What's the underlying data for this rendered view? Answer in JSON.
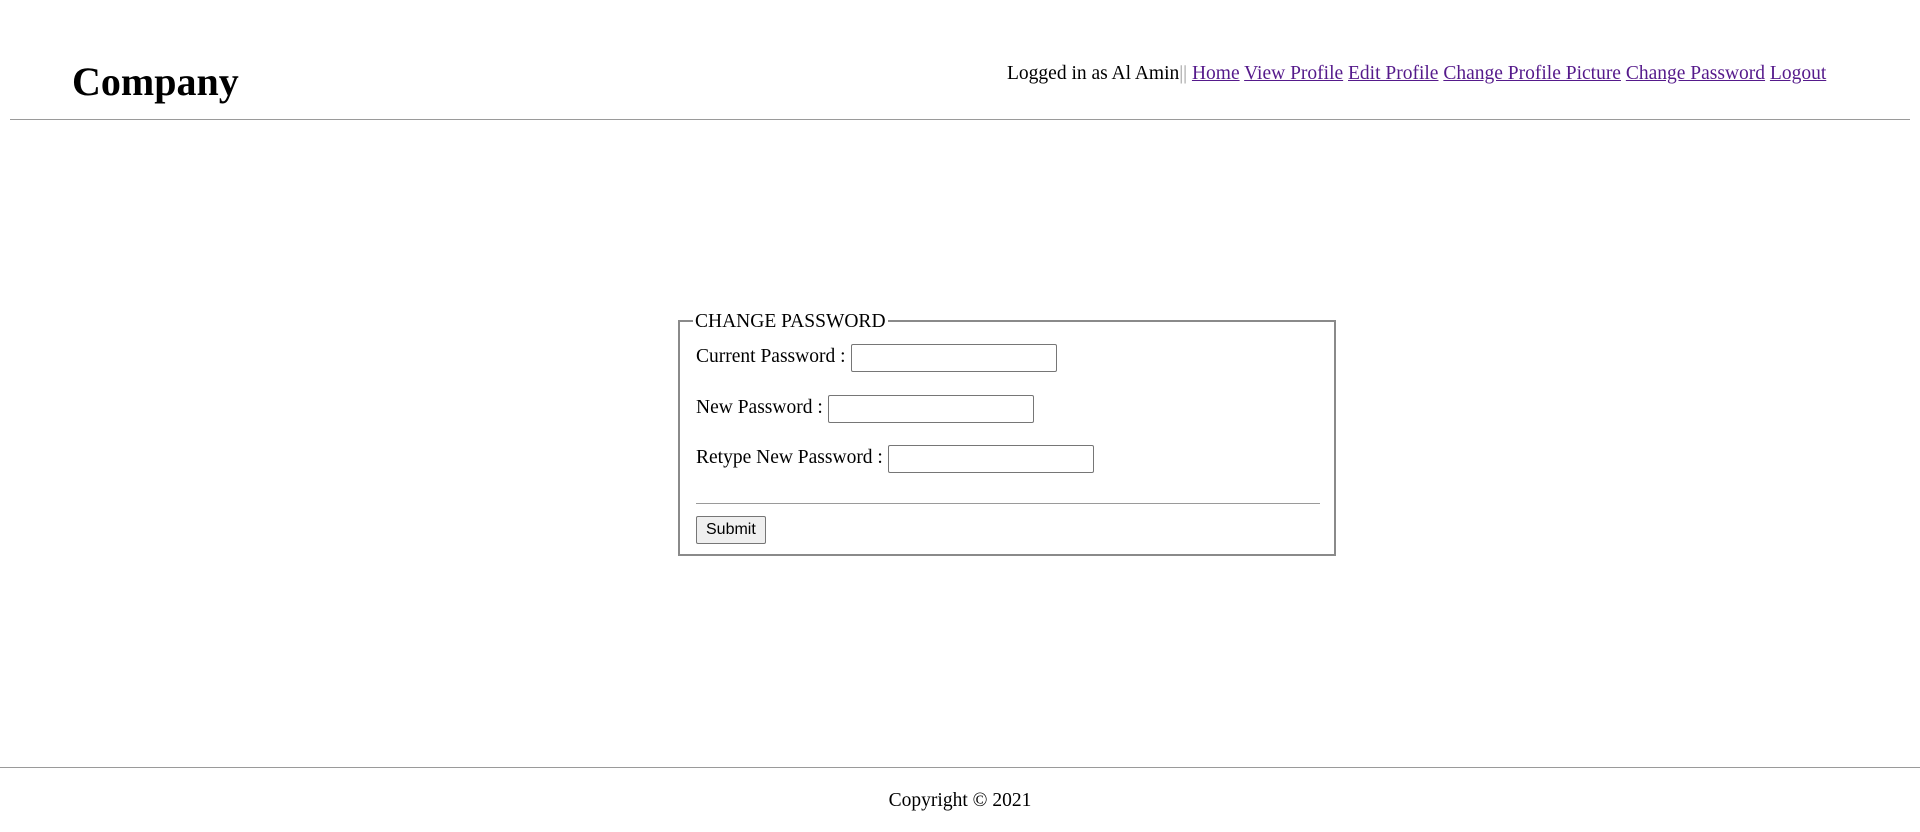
{
  "header": {
    "brand": "Company",
    "logged_in_text": "Logged in as Al Amin",
    "separator": "||",
    "links": [
      {
        "label": "Home"
      },
      {
        "label": "View Profile"
      },
      {
        "label": "Edit Profile"
      },
      {
        "label": "Change Profile Picture"
      },
      {
        "label": "Change Password"
      },
      {
        "label": "Logout"
      }
    ]
  },
  "form": {
    "legend": "CHANGE PASSWORD",
    "current_password_label": "Current Password :",
    "current_password_value": "",
    "new_password_label": "New Password :",
    "new_password_value": "",
    "retype_password_label": "Retype New Password :",
    "retype_password_value": "",
    "submit_label": "Submit"
  },
  "footer": {
    "copyright": "Copyright © 2021"
  },
  "colors": {
    "link": "#551a8b",
    "rule": "#9a9a9a",
    "text": "#000000",
    "background": "#ffffff"
  }
}
